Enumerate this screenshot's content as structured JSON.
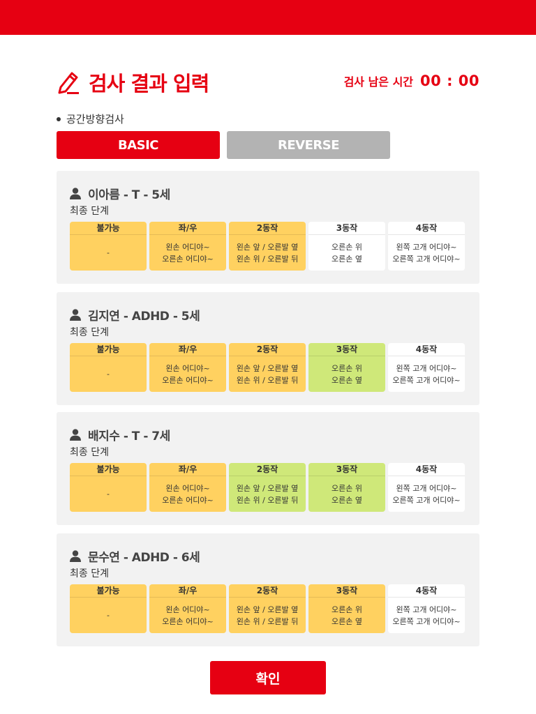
{
  "header": {
    "title": "검사 결과 입력",
    "timer_label": "검사 남은 시간",
    "timer_value": "00 : 00"
  },
  "section_label": "공간방향검사",
  "tabs": [
    {
      "label": "BASIC",
      "active": true
    },
    {
      "label": "REVERSE",
      "active": false
    }
  ],
  "final_label": "최종 단계",
  "stage_headers": [
    "불가능",
    "좌/우",
    "2동작",
    "3동작",
    "4동작"
  ],
  "stage_contents": [
    [
      "-"
    ],
    [
      "왼손 어디야~",
      "오른손 어디야~"
    ],
    [
      "왼손 앞 / 오른발 옆",
      "왼손 위 / 오른발 뒤"
    ],
    [
      "오른손 위",
      "오른손 옆"
    ],
    [
      "왼쪽 고개 어디야~",
      "오른쪽 고개 어디야~"
    ]
  ],
  "patients": [
    {
      "name": "이아름 - T - 5세",
      "status": [
        "yellow",
        "yellow",
        "yellow",
        "white",
        "white"
      ]
    },
    {
      "name": "김지연  -  ADHD  -  5세",
      "status": [
        "yellow",
        "yellow",
        "yellow",
        "green",
        "white"
      ]
    },
    {
      "name": "배지수 - T - 7세",
      "status": [
        "yellow",
        "yellow",
        "green",
        "green",
        "white"
      ]
    },
    {
      "name": "문수연 - ADHD - 6세",
      "status": [
        "yellow",
        "yellow",
        "yellow",
        "yellow",
        "white"
      ]
    }
  ],
  "colors": {
    "brand": "#e60012",
    "yellow": "#ffd160",
    "green": "#cfe879",
    "white": "#ffffff",
    "inactive_tab": "#b3b3b3",
    "card_bg": "#f2f2f2"
  },
  "icons": {
    "title": "pencil-icon",
    "patient": "user-icon"
  },
  "confirm_label": "확인"
}
